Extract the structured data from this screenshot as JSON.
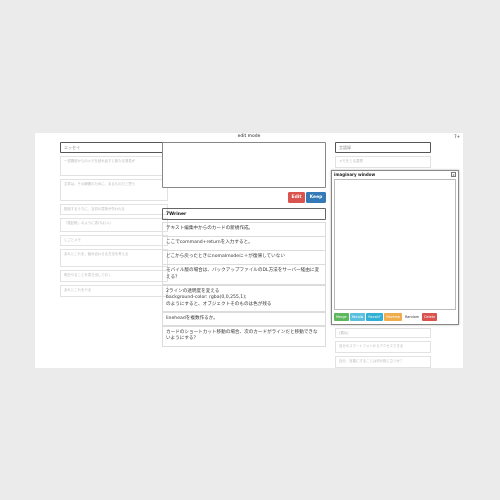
{
  "window_title": "edit mode",
  "corner_label": "7+",
  "left_column": {
    "search_placeholder": "エッセイ",
    "cards": [
      "一週間前からのメモを読み返すと新たな発見が",
      "文章は、その瞬間のために、あるものだと思う",
      "推敲するうちに、当初の意味が失われる",
      "「雑記帳」のように書けばいい",
      "しごとメモ",
      "あれとこれを、組み合わせる方法を考える",
      "明日やることを書き出しておく",
      "あれとこれをやる"
    ]
  },
  "right_column": {
    "search_placeholder": "言語録",
    "cards": [
      "メモをとる習慣",
      "[類似]",
      "自分のスマートフォンからアクセスできる",
      "自分、言葉にすることは何の役に立つか？"
    ]
  },
  "editor": {
    "edit_label": "Edit",
    "keep_label": "Keep",
    "title_value": "7Wriner"
  },
  "main_cards": [
    "テキスト編集中からのカードの新規作成。",
    "ここでcommand+returnを入力すると。",
    "どこから戻ったときにnomalmodeに＋が復帰していない",
    "モバイル版の場合は、バックアップファイルのDL方法をサーバー経由に変える？",
    "2ラインの透明度を変える\nbackground-color: rgba(0,0,255,1);\nのようにすると、オブジェクトそのものは色が残る",
    "lineheadを複数作るか。",
    "カードのショートカット移動の場合、次のカードがラインだと移動できないようにする？"
  ],
  "imaginary_window": {
    "title": "imaginary window",
    "close_symbol": "x",
    "buttons": [
      {
        "label": "Merge",
        "color": "#5cb85c"
      },
      {
        "label": "Recall▸",
        "color": "#5bc0de"
      },
      {
        "label": "Recall↑",
        "color": "#31b0d5"
      },
      {
        "label": "Reverse",
        "color": "#f0ad4e"
      },
      {
        "label": "Random",
        "color": "#ffffff"
      },
      {
        "label": "Delete",
        "color": "#d9534f"
      }
    ]
  }
}
